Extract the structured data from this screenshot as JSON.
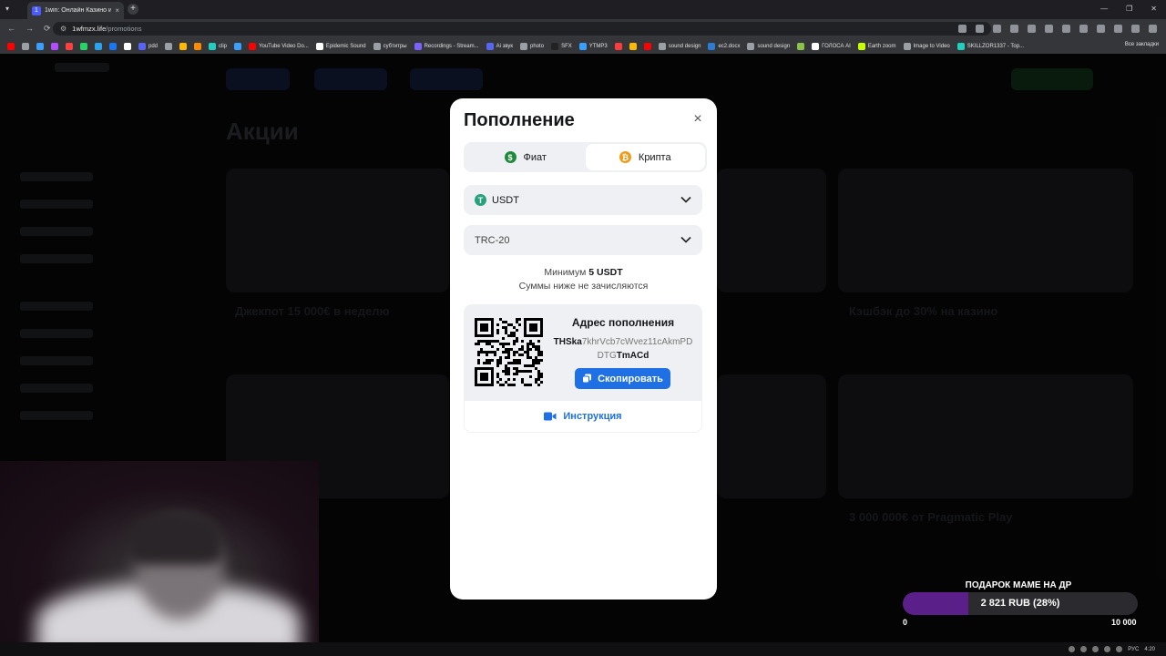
{
  "browser": {
    "tab_title": "1win: Онлайн Казино и Ставки",
    "url_host": "1wfmzx.life",
    "url_path": "/promotions",
    "bookmarks": [
      {
        "label": "",
        "color": "#ff0000"
      },
      {
        "label": "",
        "color": "#9aa0a6"
      },
      {
        "label": "",
        "color": "#3aa0ff"
      },
      {
        "label": "",
        "color": "#b14cff"
      },
      {
        "label": "",
        "color": "#ff4040"
      },
      {
        "label": "",
        "color": "#25d366"
      },
      {
        "label": "",
        "color": "#2aa3ef"
      },
      {
        "label": "",
        "color": "#1877f2"
      },
      {
        "label": "",
        "color": "#ffffff"
      },
      {
        "label": "pdd",
        "color": "#5865f2"
      },
      {
        "label": "",
        "color": "#9aa0a6"
      },
      {
        "label": "",
        "color": "#ffb800"
      },
      {
        "label": "",
        "color": "#ff8a00"
      },
      {
        "label": "clip",
        "color": "#1fcfc0"
      },
      {
        "label": "",
        "color": "#3aa0ff"
      },
      {
        "label": "YouTube Video Do...",
        "color": "#ff0000"
      },
      {
        "label": "Epidemic Sound",
        "color": "#ffffff"
      },
      {
        "label": "субтитры",
        "color": "#9aa0a6"
      },
      {
        "label": "Recordings - Stream...",
        "color": "#7b61ff"
      },
      {
        "label": "Ai звук",
        "color": "#5865f2"
      },
      {
        "label": "photo",
        "color": "#9aa0a6"
      },
      {
        "label": "SFX",
        "color": "#222222"
      },
      {
        "label": "YTMP3",
        "color": "#3aa0ff"
      },
      {
        "label": "",
        "color": "#ff3b3b"
      },
      {
        "label": "",
        "color": "#ffb800"
      },
      {
        "label": "",
        "color": "#ff0000"
      },
      {
        "label": "sound design",
        "color": "#9aa0a6"
      },
      {
        "label": "ec2.docx",
        "color": "#2b7cd3"
      },
      {
        "label": "sound design",
        "color": "#9aa0a6"
      },
      {
        "label": "",
        "color": "#8bc34a"
      },
      {
        "label": "ГОЛОСА AI",
        "color": "#ffffff"
      },
      {
        "label": "Earth zoom",
        "color": "#c6ff00"
      },
      {
        "label": "Image to Video",
        "color": "#9aa0a6"
      },
      {
        "label": "SKILLZOR1337 - Top...",
        "color": "#1fcfc0"
      }
    ],
    "bookmarks_right": "Все закладки"
  },
  "modal": {
    "title": "Пополнение",
    "close_icon": "×",
    "tabs": [
      {
        "label": "Фиат",
        "icon": "$",
        "icon_color": "#1f8a3b",
        "active": false
      },
      {
        "label": "Крипта",
        "icon": "₿",
        "icon_color": "#f09a1a",
        "active": true
      }
    ],
    "currency": {
      "label": "USDT",
      "icon": "T",
      "icon_color": "#26a17b"
    },
    "network": {
      "label": "TRC-20"
    },
    "minimum_prefix": "Минимум ",
    "minimum_value": "5 USDT",
    "minimum_note": "Суммы ниже не зачисляются",
    "address_title": "Адрес пополнения",
    "address_start": "THSka",
    "address_middle": "7khrVcb7cWvez11cAkmPDDTG",
    "address_end": "TmACd",
    "copy_label": "Скопировать",
    "instruction_label": "Инструкция",
    "accent_color": "#1f6fe5"
  },
  "donation_goal": {
    "title": "ПОДАРОК МАМЕ НА ДР",
    "progress_text": "2 821 RUB (28%)",
    "progress_fraction": 0.28,
    "min_label": "0",
    "max_label": "10 000",
    "fill_color": "#5b1f8a"
  },
  "taskbar": {
    "lang": "РУС",
    "time": "4:20"
  },
  "background_page": {
    "title": "Акции",
    "card_labels": [
      "Джекпот 15 000€ в неделю",
      "Кэшбэк до 30% на казино",
      "3 000 000€ от Pragmatic Play"
    ]
  }
}
